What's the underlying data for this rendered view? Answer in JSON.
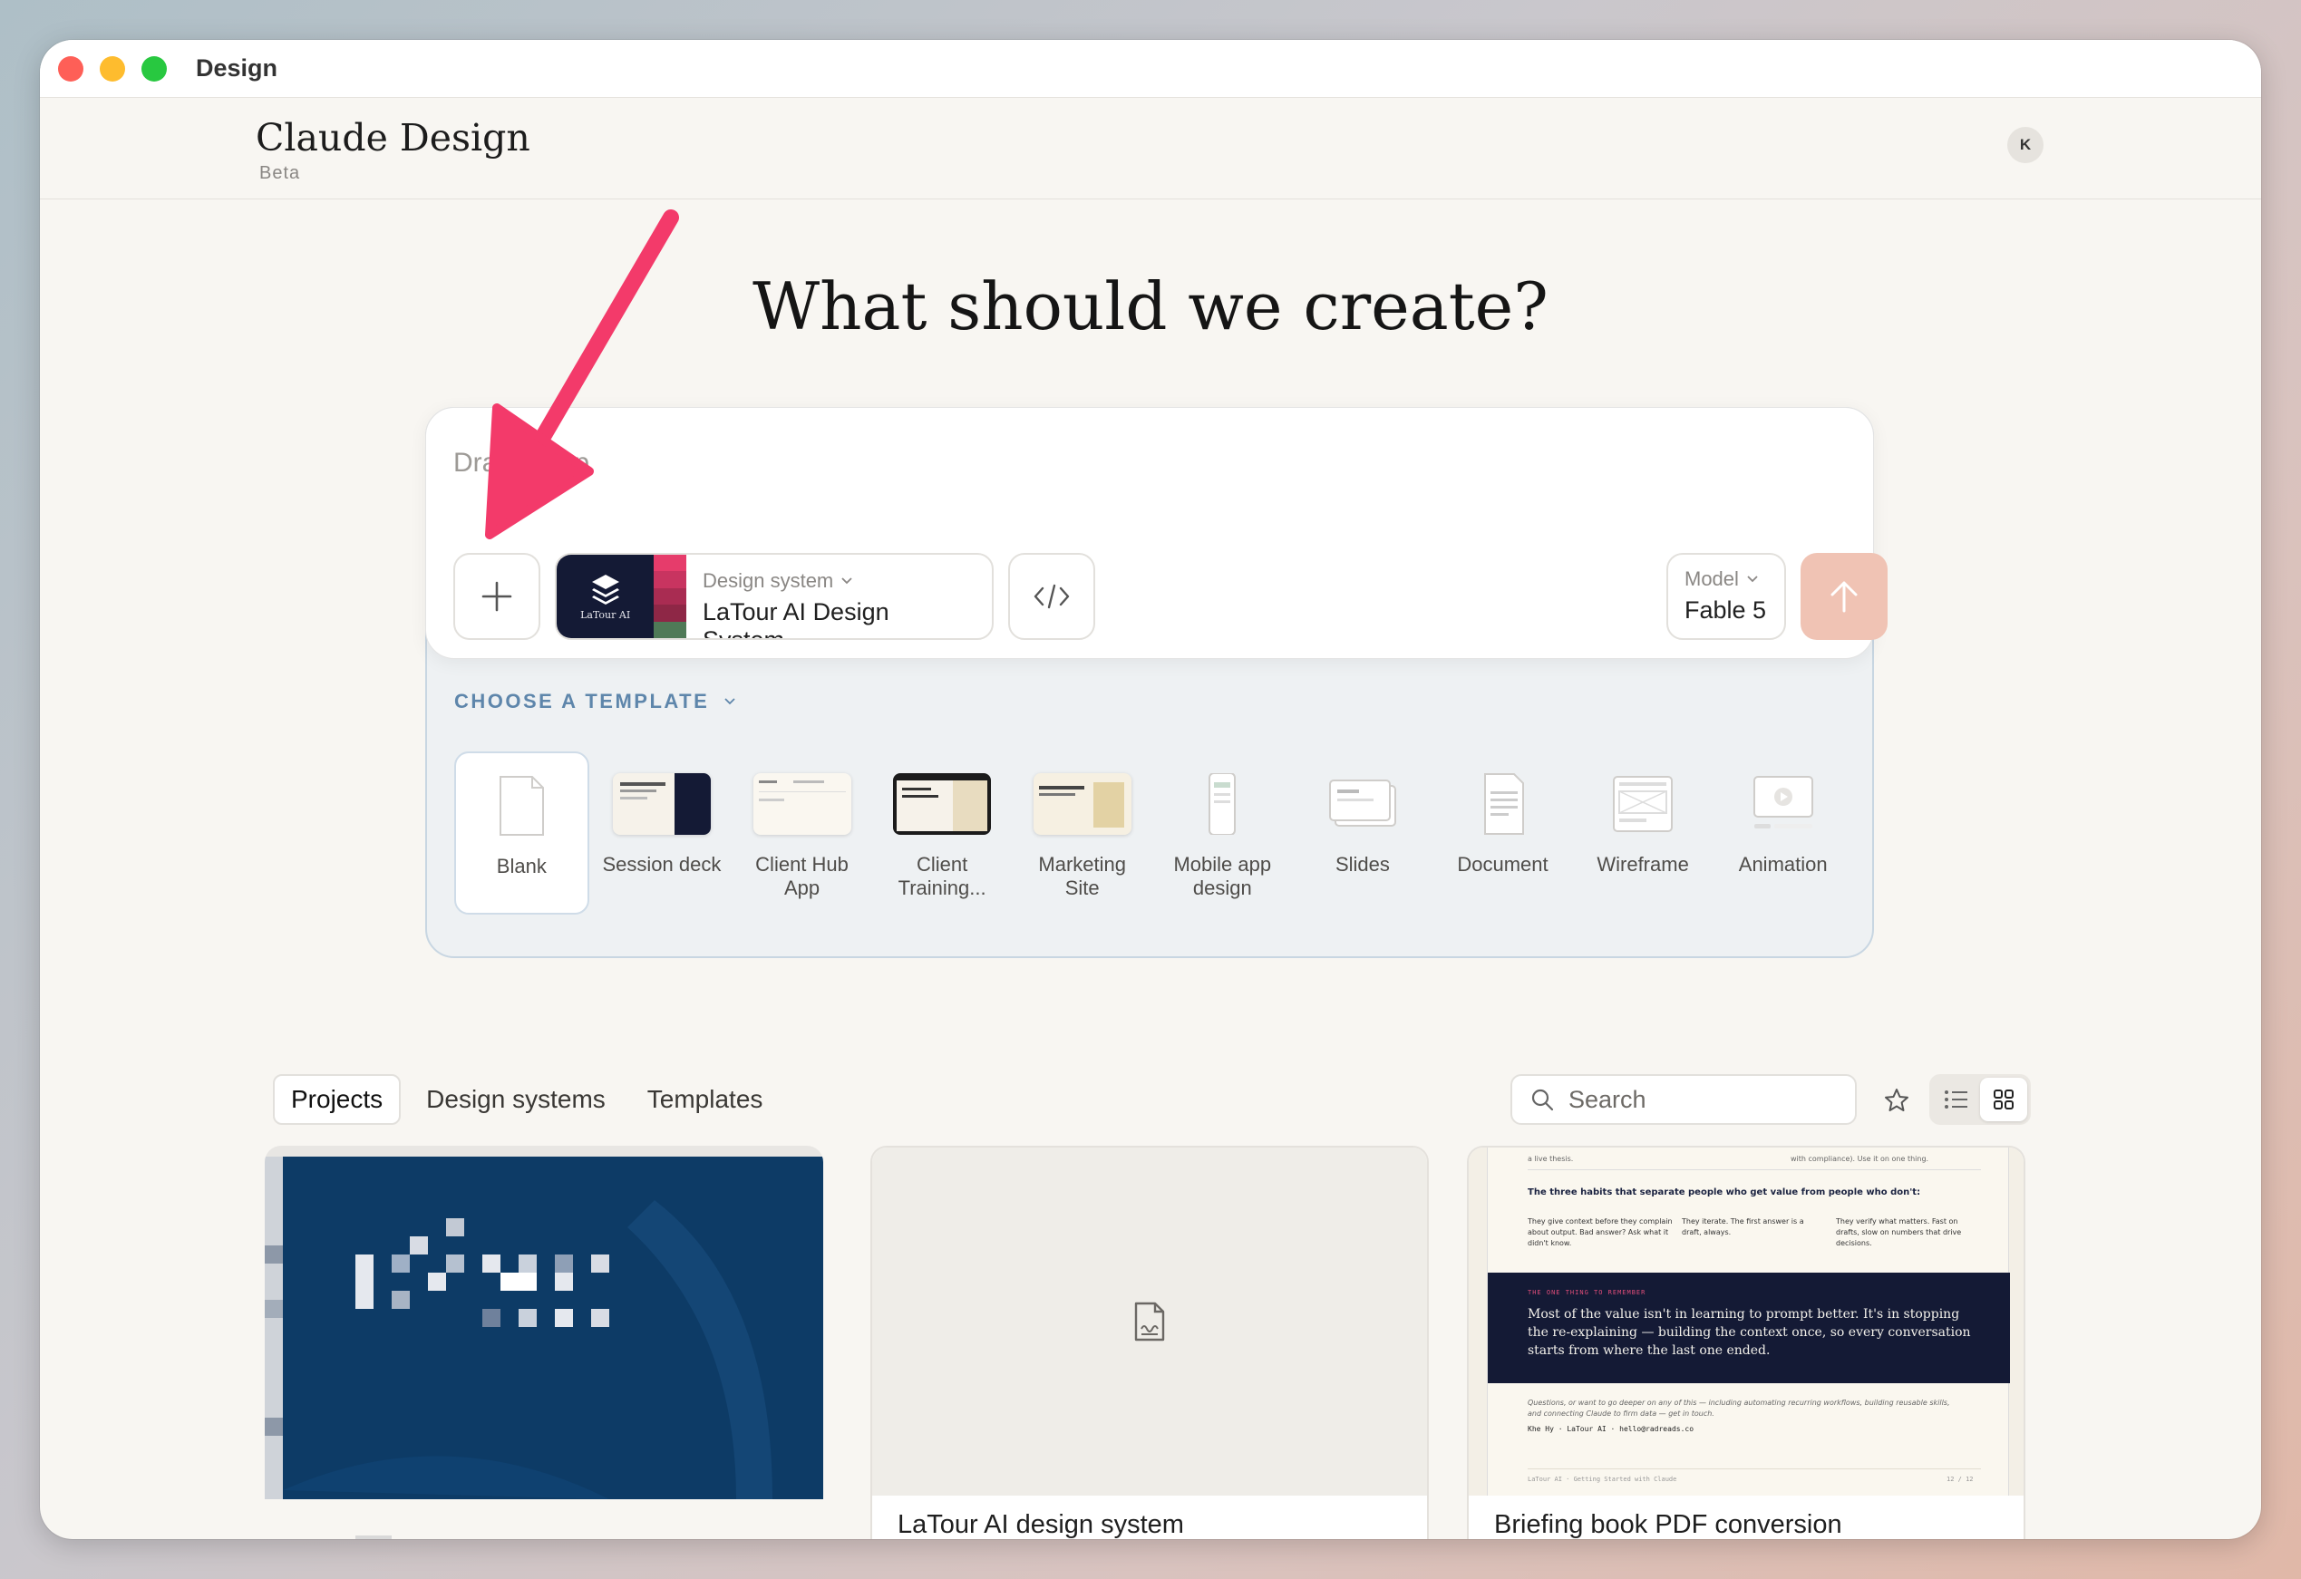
{
  "window": {
    "title": "Design"
  },
  "header": {
    "brand": "Claude Design",
    "badge": "Beta",
    "avatar_initial": "K"
  },
  "headline": "What should we create?",
  "composer": {
    "placeholder": "Drag one-p",
    "design_system": {
      "label": "Design system",
      "value": "LaTour AI Design System",
      "thumb_text": "LaTour AI"
    },
    "model": {
      "label": "Model",
      "value": "Fable 5"
    }
  },
  "templates": {
    "header": "CHOOSE A TEMPLATE",
    "items": [
      {
        "name": "Blank",
        "selected": true
      },
      {
        "name": "Session deck"
      },
      {
        "name": "Client Hub App"
      },
      {
        "name": "Client Training..."
      },
      {
        "name": "Marketing Site"
      },
      {
        "name": "Mobile app design"
      },
      {
        "name": "Slides"
      },
      {
        "name": "Document"
      },
      {
        "name": "Wireframe"
      },
      {
        "name": "Animation"
      }
    ]
  },
  "tabs": [
    {
      "label": "Projects",
      "active": true
    },
    {
      "label": "Design systems"
    },
    {
      "label": "Templates"
    }
  ],
  "search": {
    "placeholder": "Search"
  },
  "projects": [
    {
      "title": ""
    },
    {
      "title": "LaTour AI design system"
    },
    {
      "title": "Briefing book PDF conversion",
      "preview": {
        "top_note_left": "a live thesis.",
        "top_note_right": "with compliance). Use it on one thing.",
        "habits_heading": "The three habits that separate people who get value from people who don't:",
        "habit1": "They give context before they complain about output. Bad answer? Ask what it didn't know.",
        "habit2": "They iterate. The first answer is a draft, always.",
        "habit3": "They verify what matters. Fast on drafts, slow on numbers that drive decisions.",
        "remember_label": "THE ONE THING TO REMEMBER",
        "remember_text": "Most of the value isn't in learning to prompt better. It's in stopping the re-explaining — building the context once, so every conversation starts from where the last one ended.",
        "footer_note": "Questions, or want to go deeper on any of this — including automating recurring workflows, building reusable skills, and connecting Claude to firm data — get in touch.",
        "contact": "Khe Hy · LaTour AI · hello@radreads.co",
        "page_footer_left": "LaTour AI · Getting Started with Claude",
        "page_footer_right": "12 / 12"
      }
    }
  ],
  "colors": {
    "accent": "#f0c3b4",
    "arrow": "#f33a6a",
    "template_header": "#5e86ab",
    "ds_navy": "#141a35",
    "project_blue": "#0d3b66"
  }
}
